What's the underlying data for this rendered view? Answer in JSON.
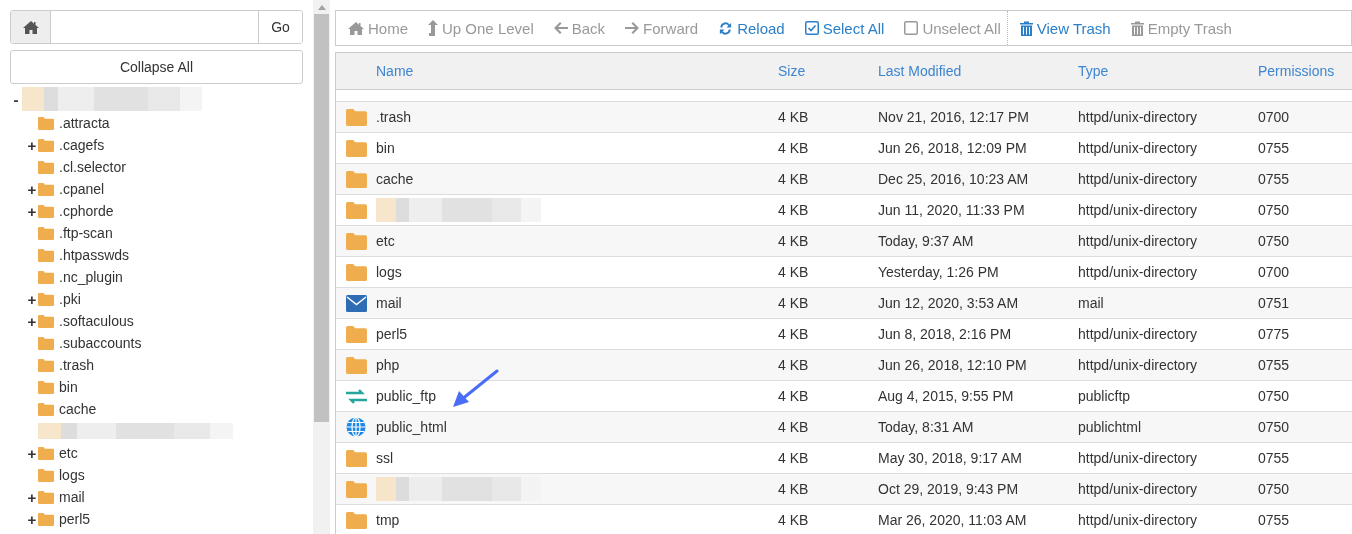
{
  "sidebar": {
    "go_button": "Go",
    "collapse_button": "Collapse All",
    "tree": [
      {
        "kind": "redacted",
        "toggle": "-",
        "children": [
          {
            "kind": "folder",
            "label": ".attracta"
          },
          {
            "kind": "folder",
            "label": ".cagefs",
            "toggle": "+"
          },
          {
            "kind": "folder",
            "label": ".cl.selector"
          },
          {
            "kind": "folder",
            "label": ".cpanel",
            "toggle": "+"
          },
          {
            "kind": "folder",
            "label": ".cphorde",
            "toggle": "+"
          },
          {
            "kind": "folder",
            "label": ".ftp-scan"
          },
          {
            "kind": "folder",
            "label": ".htpasswds"
          },
          {
            "kind": "folder",
            "label": ".nc_plugin"
          },
          {
            "kind": "folder",
            "label": ".pki",
            "toggle": "+"
          },
          {
            "kind": "folder",
            "label": ".softaculous",
            "toggle": "+"
          },
          {
            "kind": "folder",
            "label": ".subaccounts"
          },
          {
            "kind": "folder",
            "label": ".trash"
          },
          {
            "kind": "folder",
            "label": "bin"
          },
          {
            "kind": "folder",
            "label": "cache"
          },
          {
            "kind": "redacted"
          },
          {
            "kind": "folder",
            "label": "etc",
            "toggle": "+"
          },
          {
            "kind": "folder",
            "label": "logs"
          },
          {
            "kind": "folder",
            "label": "mail",
            "toggle": "+"
          },
          {
            "kind": "folder",
            "label": "perl5",
            "toggle": "+"
          }
        ]
      }
    ]
  },
  "toolbar": [
    {
      "kind": "home",
      "label": "Home",
      "disabled": true
    },
    {
      "kind": "up",
      "label": "Up One Level",
      "disabled": true
    },
    {
      "kind": "back",
      "label": "Back",
      "disabled": true
    },
    {
      "kind": "forward",
      "label": "Forward",
      "disabled": true
    },
    {
      "kind": "reload",
      "label": "Reload",
      "disabled": false
    },
    {
      "kind": "select",
      "label": "Select All",
      "disabled": false
    },
    {
      "kind": "unselect",
      "label": "Unselect All",
      "disabled": true
    },
    {
      "kind": "separator"
    },
    {
      "kind": "trash",
      "label": "View Trash",
      "disabled": false
    },
    {
      "kind": "trash",
      "label": "Empty Trash",
      "disabled": true
    }
  ],
  "table": {
    "columns": [
      "Name",
      "Size",
      "Last Modified",
      "Type",
      "Permissions"
    ],
    "rows": [
      {
        "kind": "folder",
        "name": ".trash",
        "size": "4 KB",
        "modified": "Nov 21, 2016, 12:17 PM",
        "type": "httpd/unix-directory",
        "permissions": "0700"
      },
      {
        "kind": "folder",
        "name": "bin",
        "size": "4 KB",
        "modified": "Jun 26, 2018, 12:09 PM",
        "type": "httpd/unix-directory",
        "permissions": "0755"
      },
      {
        "kind": "folder",
        "name": "cache",
        "size": "4 KB",
        "modified": "Dec 25, 2016, 10:23 AM",
        "type": "httpd/unix-directory",
        "permissions": "0755"
      },
      {
        "kind": "folder",
        "redacted": true,
        "size": "4 KB",
        "modified": "Jun 11, 2020, 11:33 PM",
        "type": "httpd/unix-directory",
        "permissions": "0750"
      },
      {
        "kind": "folder",
        "name": "etc",
        "size": "4 KB",
        "modified": "Today, 9:37 AM",
        "type": "httpd/unix-directory",
        "permissions": "0750"
      },
      {
        "kind": "folder",
        "name": "logs",
        "size": "4 KB",
        "modified": "Yesterday, 1:26 PM",
        "type": "httpd/unix-directory",
        "permissions": "0700"
      },
      {
        "kind": "mail",
        "name": "mail",
        "size": "4 KB",
        "modified": "Jun 12, 2020, 3:53 AM",
        "type": "mail",
        "permissions": "0751"
      },
      {
        "kind": "folder",
        "name": "perl5",
        "size": "4 KB",
        "modified": "Jun 8, 2018, 2:16 PM",
        "type": "httpd/unix-directory",
        "permissions": "0775"
      },
      {
        "kind": "folder",
        "name": "php",
        "size": "4 KB",
        "modified": "Jun 26, 2018, 12:10 PM",
        "type": "httpd/unix-directory",
        "permissions": "0755"
      },
      {
        "kind": "ftp",
        "name": "public_ftp",
        "size": "4 KB",
        "modified": "Aug 4, 2015, 9:55 PM",
        "type": "publicftp",
        "permissions": "0750"
      },
      {
        "kind": "globe",
        "name": "public_html",
        "size": "4 KB",
        "modified": "Today, 8:31 AM",
        "type": "publichtml",
        "permissions": "0750"
      },
      {
        "kind": "folder",
        "name": "ssl",
        "size": "4 KB",
        "modified": "May 30, 2018, 9:17 AM",
        "type": "httpd/unix-directory",
        "permissions": "0755"
      },
      {
        "kind": "folder",
        "redacted": true,
        "size": "4 KB",
        "modified": "Oct 29, 2019, 9:43 PM",
        "type": "httpd/unix-directory",
        "permissions": "0750"
      },
      {
        "kind": "folder",
        "name": "tmp",
        "size": "4 KB",
        "modified": "Mar 26, 2020, 11:03 AM",
        "type": "httpd/unix-directory",
        "permissions": "0755"
      }
    ]
  },
  "annotation": {
    "kind": "arrow"
  }
}
